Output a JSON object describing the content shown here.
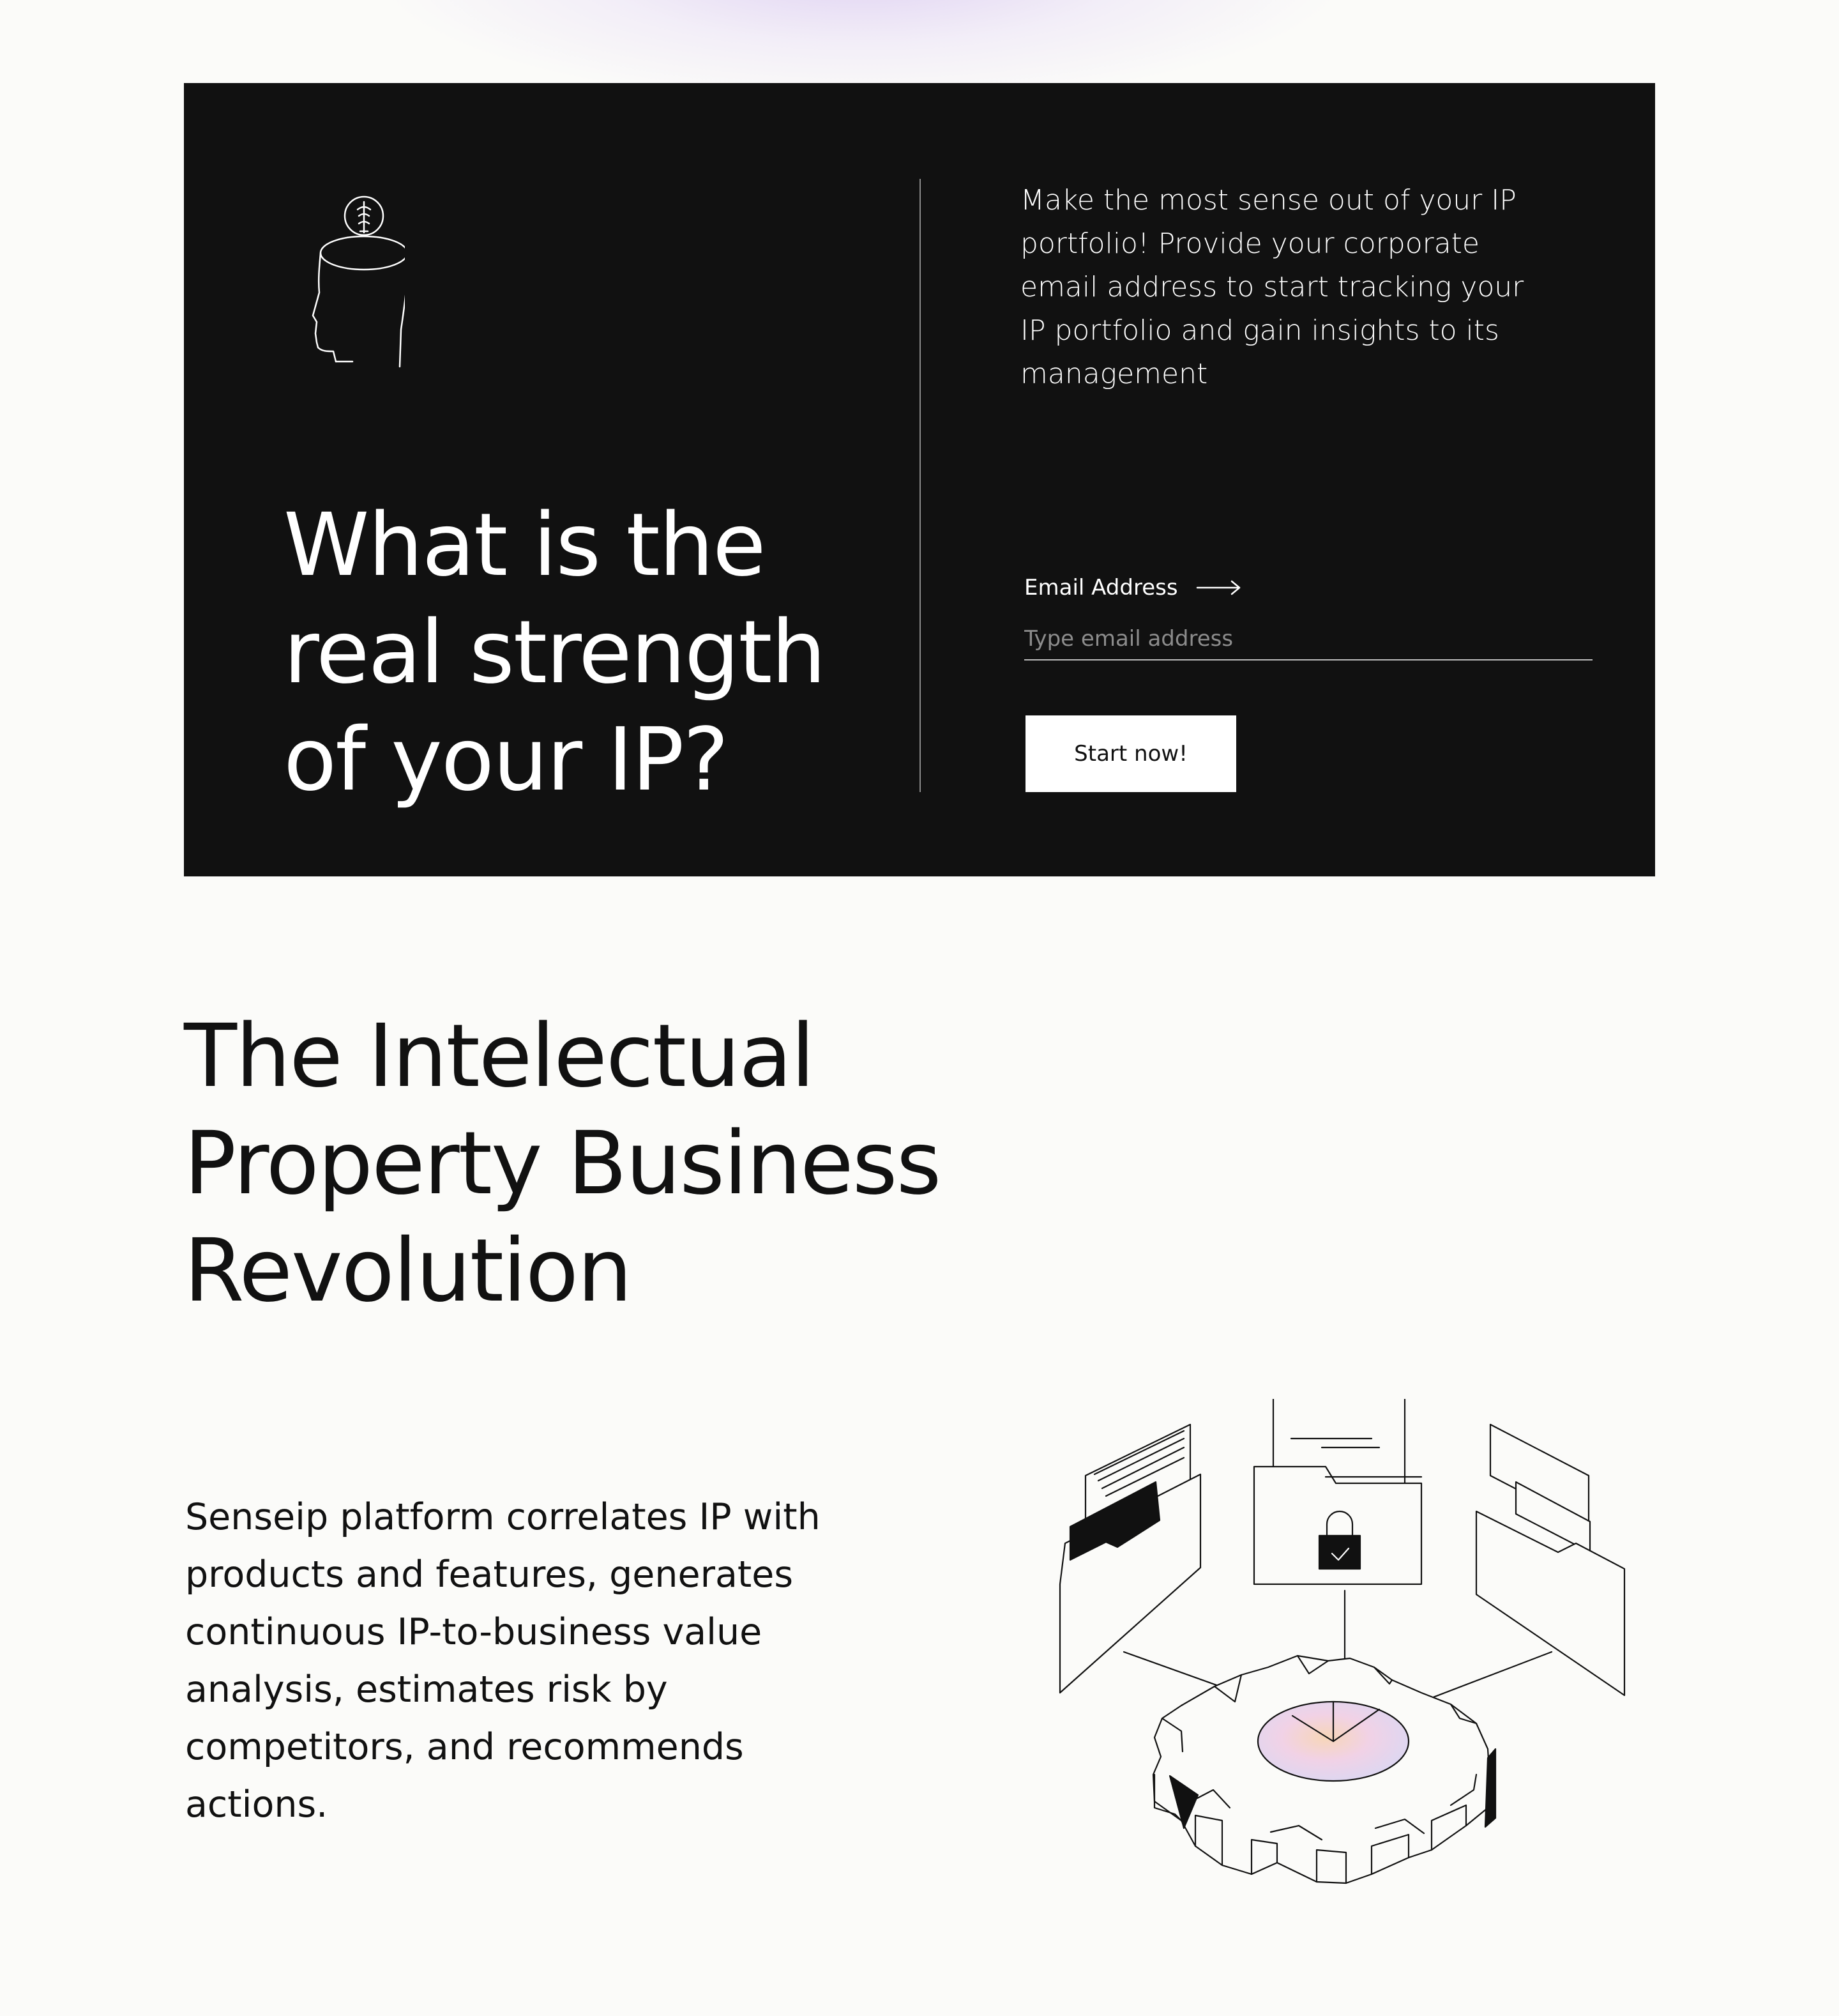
{
  "cta": {
    "title": "What is the real strength of your IP?",
    "description": "Make the most sense out of your IP portfolio! Provide your corporate email address to start tracking your IP portfolio and gain insights to its management",
    "email_label": "Email Address",
    "email_placeholder": "Type email address",
    "email_value": "",
    "button_label": "Start now!",
    "icon": "head-lightbulb-icon"
  },
  "section": {
    "title": "The Intelectual Property Business Revolution",
    "body": "Senseip platform correlates IP with products and features, generates continuous IP-to-business value analysis, estimates risk by competitors, and recommends actions.",
    "illustration": "gear-documents-lock-illustration"
  },
  "colors": {
    "background": "#fbfbf9",
    "panel": "#111111",
    "text_dark": "#111111",
    "text_light": "#ffffff",
    "accent_glow": "#d6c4f0"
  }
}
